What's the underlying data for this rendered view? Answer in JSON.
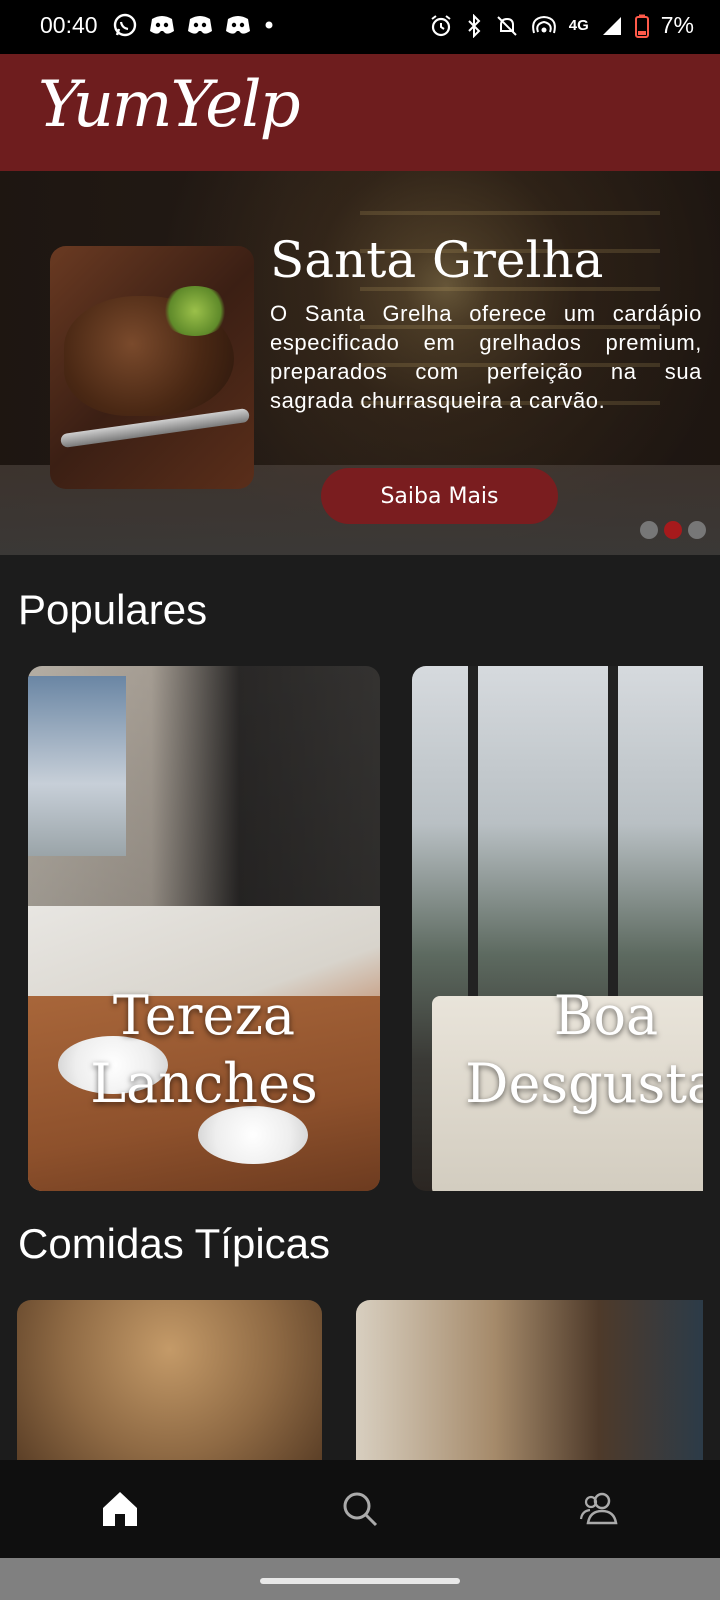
{
  "status_bar": {
    "time": "00:40",
    "network": "4G",
    "battery": "7%",
    "icons": [
      "whatsapp-icon",
      "discord-icon",
      "discord-icon",
      "discord-icon",
      "dot-icon",
      "alarm-icon",
      "bluetooth-icon",
      "mute-icon",
      "hotspot-icon",
      "signal-icon",
      "battery-low-icon"
    ]
  },
  "header": {
    "logo": "YumYelp",
    "accent_color": "#6e1d1e"
  },
  "hero": {
    "title": "Santa Grelha",
    "description": "O Santa Grelha oferece um cardápio especificado em grelhados premium, preparados com perfeição na sua sagrada churrasqueira a carvão.",
    "button_label": "Saiba Mais",
    "carousel_total": 3,
    "carousel_active_index": 1
  },
  "sections": {
    "popular": {
      "title": "Populares",
      "cards": [
        {
          "label_line1": "Tereza",
          "label_line2": "Lanches"
        },
        {
          "label_line1": "Boa",
          "label_line2": "Desgustas"
        }
      ]
    },
    "typical": {
      "title": "Comidas Típicas"
    }
  },
  "bottom_nav": {
    "items": [
      {
        "icon": "home-icon",
        "active": true
      },
      {
        "icon": "search-icon",
        "active": false
      },
      {
        "icon": "users-icon",
        "active": false
      }
    ]
  }
}
